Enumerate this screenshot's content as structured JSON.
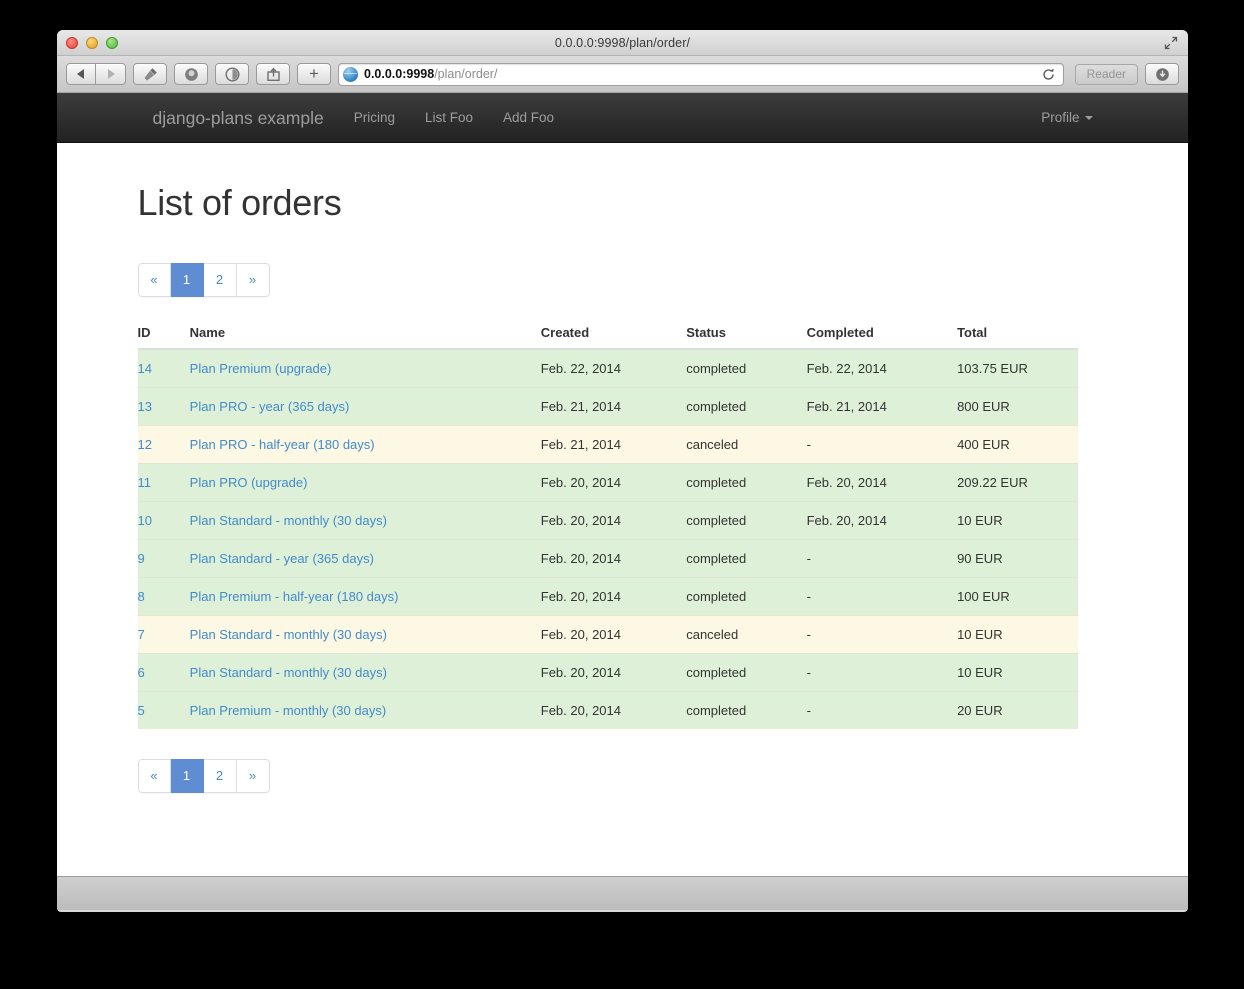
{
  "window": {
    "title": "0.0.0.0:9998/plan/order/",
    "traffic_lights": [
      "close",
      "minimize",
      "maximize"
    ],
    "fullscreen_icon": "expand-arrows-icon"
  },
  "toolbar": {
    "back_icon": "back-arrow-icon",
    "forward_icon": "forward-arrow-icon",
    "flashlight_icon": "flashlight-icon",
    "top-sites_icon": "top-sites-icon",
    "reading-list_icon": "reading-list-icon",
    "share_icon": "share-icon",
    "new-tab_label": "+",
    "url_host": "0.0.0.0:9998",
    "url_path": "/plan/order/",
    "reload_icon": "reload-icon",
    "reader_label": "Reader",
    "downloads_icon": "downloads-icon"
  },
  "navbar": {
    "brand": "django-plans example",
    "links": [
      {
        "label": "Pricing"
      },
      {
        "label": "List Foo"
      },
      {
        "label": "Add Foo"
      }
    ],
    "profile": {
      "label": "Profile",
      "caret_icon": "caret-down-icon"
    }
  },
  "page": {
    "title": "List of orders"
  },
  "pagination": {
    "prev_label": "«",
    "next_label": "»",
    "pages": [
      "1",
      "2"
    ],
    "active": "1"
  },
  "table": {
    "columns": [
      "ID",
      "Name",
      "Created",
      "Status",
      "Completed",
      "Total"
    ],
    "rows": [
      {
        "id": "14",
        "name": "Plan Premium (upgrade)",
        "created": "Feb. 22, 2014",
        "status": "completed",
        "completed": "Feb. 22, 2014",
        "total": "103.75 EUR",
        "state": "completed"
      },
      {
        "id": "13",
        "name": "Plan PRO - year (365 days)",
        "created": "Feb. 21, 2014",
        "status": "completed",
        "completed": "Feb. 21, 2014",
        "total": "800 EUR",
        "state": "completed"
      },
      {
        "id": "12",
        "name": "Plan PRO - half-year (180 days)",
        "created": "Feb. 21, 2014",
        "status": "canceled",
        "completed": "-",
        "total": "400 EUR",
        "state": "canceled"
      },
      {
        "id": "11",
        "name": "Plan PRO (upgrade)",
        "created": "Feb. 20, 2014",
        "status": "completed",
        "completed": "Feb. 20, 2014",
        "total": "209.22 EUR",
        "state": "completed"
      },
      {
        "id": "10",
        "name": "Plan Standard - monthly (30 days)",
        "created": "Feb. 20, 2014",
        "status": "completed",
        "completed": "Feb. 20, 2014",
        "total": "10 EUR",
        "state": "completed"
      },
      {
        "id": "9",
        "name": "Plan Standard - year (365 days)",
        "created": "Feb. 20, 2014",
        "status": "completed",
        "completed": "-",
        "total": "90 EUR",
        "state": "completed"
      },
      {
        "id": "8",
        "name": "Plan Premium - half-year (180 days)",
        "created": "Feb. 20, 2014",
        "status": "completed",
        "completed": "-",
        "total": "100 EUR",
        "state": "completed"
      },
      {
        "id": "7",
        "name": "Plan Standard - monthly (30 days)",
        "created": "Feb. 20, 2014",
        "status": "canceled",
        "completed": "-",
        "total": "10 EUR",
        "state": "canceled"
      },
      {
        "id": "6",
        "name": "Plan Standard - monthly (30 days)",
        "created": "Feb. 20, 2014",
        "status": "completed",
        "completed": "-",
        "total": "10 EUR",
        "state": "completed"
      },
      {
        "id": "5",
        "name": "Plan Premium - monthly (30 days)",
        "created": "Feb. 20, 2014",
        "status": "completed",
        "completed": "-",
        "total": "20 EUR",
        "state": "completed"
      }
    ]
  },
  "colors": {
    "link": "#428bca",
    "pagination_active": "#5f8dd3",
    "row_success": "#dff0d8",
    "row_warning": "#fcf8e3",
    "navbar_dark": "#2d2d2d"
  }
}
